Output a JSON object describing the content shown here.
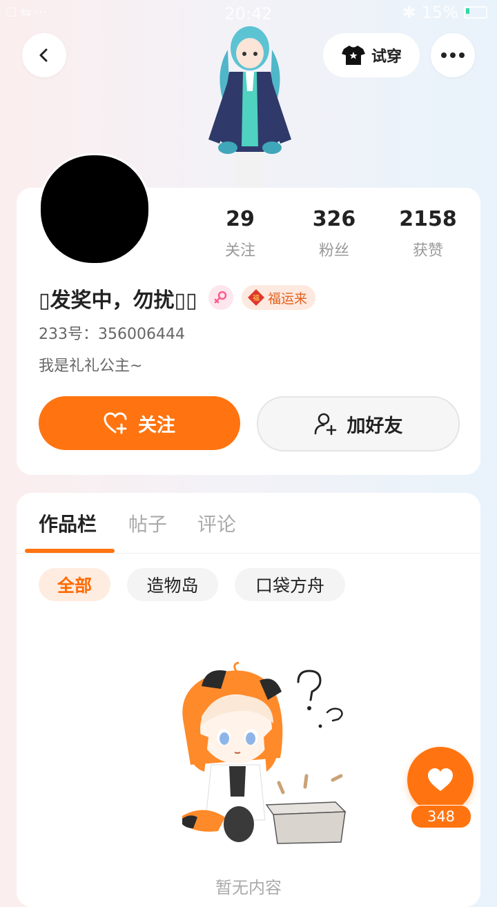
{
  "status_bar": {
    "time": "20:42",
    "left": "☐ ⇆ ···",
    "battery": "15%"
  },
  "header": {
    "try_on_label": "试穿"
  },
  "profile": {
    "stats": [
      {
        "value": "29",
        "label": "关注"
      },
      {
        "value": "326",
        "label": "粉丝"
      },
      {
        "value": "2158",
        "label": "获赞"
      }
    ],
    "name": "▯发奖中，勿扰▯▯",
    "badge_label": "福运来",
    "uid": "233号：356006444",
    "bio": "我是礼礼公主~",
    "follow_label": "关注",
    "add_friend_label": "加好友"
  },
  "tabs": [
    "作品栏",
    "帖子",
    "评论"
  ],
  "filters": [
    "全部",
    "造物岛",
    "口袋方舟"
  ],
  "empty_text": "暂无内容",
  "like": {
    "count": "348"
  },
  "colors": {
    "accent": "#ff7410",
    "chip_active_bg": "#ffece0"
  }
}
